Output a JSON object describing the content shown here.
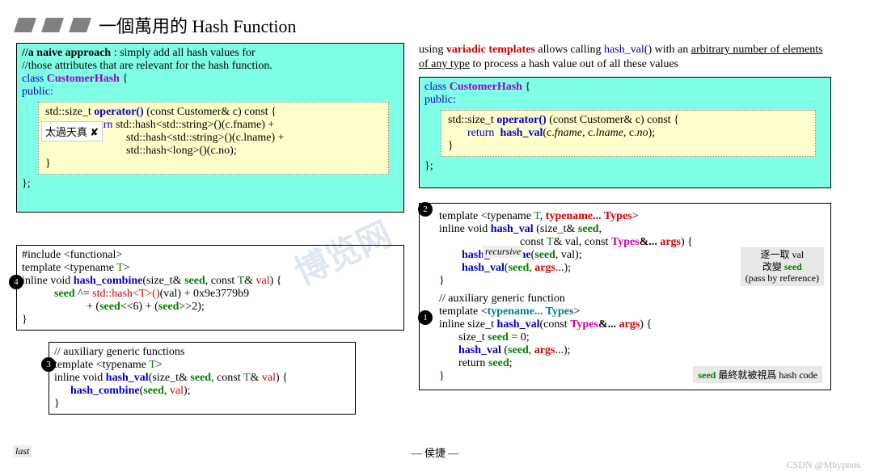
{
  "header": {
    "title": "一個萬用的 Hash Function"
  },
  "intro": {
    "line1a": "using ",
    "line1b": "variadic templates",
    "line1c": " allows calling ",
    "line1d": "hash_val",
    "line1e": "() with an ",
    "line1f": "arbitrary number of elements of any type",
    "line1g": " to process a hash value out of all these values"
  },
  "left_naive": {
    "c1": "//a naive approach",
    "c1b": " : simply add all hash values for",
    "c2": "//those attributes that are relevant for the hash function.",
    "cls1": "class  ",
    "cls2": "CustomerHash",
    "cls3": " {",
    "pub": "public:",
    "f1a": "std::size_t ",
    "f1b": "operator()",
    "f1c": " (const  Customer&  c)  const  {",
    "f2a": "return",
    "f2b": "  std::hash<std::string>()(c.fname)   +",
    "f3": "std::hash<std::string>()(c.lname)   +",
    "f4": "std::hash<long>()(c.no);",
    "f5": "}",
    "end": "};",
    "label": "太過天真 ✘"
  },
  "right_good": {
    "cls1": "class  ",
    "cls2": "CustomerHash",
    "cls3": " {",
    "pub": "public:",
    "f1a": "std::size_t ",
    "f1b": "operator()",
    "f1c": " (const Customer& c) const {",
    "f2a": "return",
    "f2b": "hash_val",
    "f2c": "(c.",
    "f2d": "fname",
    "f2e": ", c.",
    "f2f": "lname",
    "f2g": ", c.",
    "f2h": "no",
    "f2i": ");",
    "f3": "}",
    "end": "};"
  },
  "box4": {
    "l1": "#include <functional>",
    "l2a": "template <typename ",
    "l2b": "T",
    "l2c": ">",
    "l3a": "inline void ",
    "l3b": "hash_combine",
    "l3c": "(size_t& ",
    "l3d": "seed",
    "l3e": ", const ",
    "l3f": "T",
    "l3g": "& ",
    "l3h": "val",
    "l3i": ") {",
    "l4a": "seed",
    "l4b": " ^= ",
    "l4c": "std::hash<",
    "l4d": "T",
    "l4e": ">()",
    "l4f": "(val) + 0x9e3779b9",
    "l5a": "+ (",
    "l5b": "seed",
    "l5c": "<<6) + (",
    "l5d": "seed",
    "l5e": ">>2);",
    "l6": "}"
  },
  "box3": {
    "c1": "// auxiliary generic functions",
    "l2a": "template <typename ",
    "l2b": "T",
    "l2c": ">",
    "l3a": "inline void ",
    "l3b": "hash_val",
    "l3c": "(size_t& ",
    "l3d": "seed",
    "l3e": ", const ",
    "l3f": "T",
    "l3g": "& ",
    "l3h": "val",
    "l3i": ") {",
    "l4a": "hash_combine",
    "l4b": "(",
    "l4c": "seed",
    "l4d": ", ",
    "l4e": "val",
    "l4f": ");",
    "l5": "}",
    "tag": "last"
  },
  "box2": {
    "l1a": "template <typename ",
    "l1b": "T",
    "l1c": ", ",
    "l1d": "typename... Types",
    "l1e": ">",
    "l2a": "inline void ",
    "l2b": "hash_val",
    "l2c": " (size_t& ",
    "l2d": "seed",
    "l2e": ",",
    "l3a": "const ",
    "l3b": "T",
    "l3c": "& val, const ",
    "l3d": "Types",
    "l3e": "&... ",
    "l3f": "args",
    "l3g": ") {",
    "l4a": "hash_combine",
    "l4b": "(",
    "l4c": "seed",
    "l4d": ", val);",
    "l5a": "hash_val",
    "l5b": "(",
    "l5c": "seed",
    "l5d": ", ",
    "l5e": "args",
    "l5f": "...);",
    "l6": "}",
    "note1": "逐一取 val",
    "note2": "改變 seed",
    "note3": "(pass by reference)",
    "tag": "recursive"
  },
  "box1": {
    "c1": "// auxiliary generic function",
    "l2a": "template <",
    "l2b": "typename... Types",
    "l2c": ">",
    "l3a": "inline size_t ",
    "l3b": "hash_val",
    "l3c": "(const ",
    "l3d": "Types",
    "l3e": "&... ",
    "l3f": "args",
    "l3g": ") {",
    "l4a": "size_t ",
    "l4b": "seed",
    "l4c": " = 0;",
    "l5a": "hash_val",
    "l5b": " (",
    "l5c": "seed",
    "l5d": ", ",
    "l5e": "args",
    "l5f": "...);",
    "l6a": "return ",
    "l6b": "seed",
    "l6c": ";",
    "l7": "}",
    "note": "seed 最終就被視爲 hash code"
  },
  "footer": {
    "author": "— 侯捷 —",
    "watermark": "CSDN @Mhypnos",
    "wm2": "博览网"
  },
  "numbers": {
    "n1": "1",
    "n2": "2",
    "n3": "3",
    "n4": "4"
  }
}
